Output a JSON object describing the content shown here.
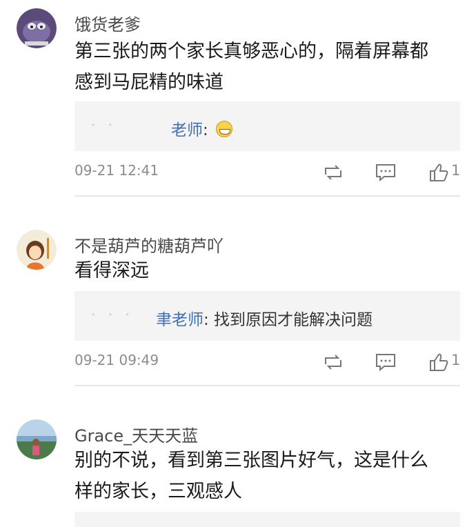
{
  "comments": [
    {
      "user": "饿货老爹",
      "text_line1": "第三张的两个家长真够恶心的，隔着屏幕都",
      "text_line2": "感到马屁精的味道",
      "reply": {
        "blur": "·  ·   ",
        "name": "老师",
        "text": ": "
      },
      "time": "09-21 12:41",
      "likes": "1"
    },
    {
      "user": "不是葫芦的糖葫芦吖",
      "text_line1": "看得深远",
      "reply": {
        "blur": "·  ·  ·",
        "name": "聿老师",
        "text": ": 找到原因才能解决问题"
      },
      "time": "09-21 09:49",
      "likes": "1"
    },
    {
      "user": "Grace_天天天蓝",
      "text_line1": "别的不说，看到第三张图片好气，这是什么",
      "text_line2": "样的家长，三观感人"
    }
  ],
  "icons": {
    "repost": "repost-icon",
    "comment": "comment-icon",
    "like": "like-icon"
  },
  "colors": {
    "reply_name": "#3f6fb5",
    "reply_bg": "#f4f4f4",
    "meta_text": "#8c8c8c"
  }
}
